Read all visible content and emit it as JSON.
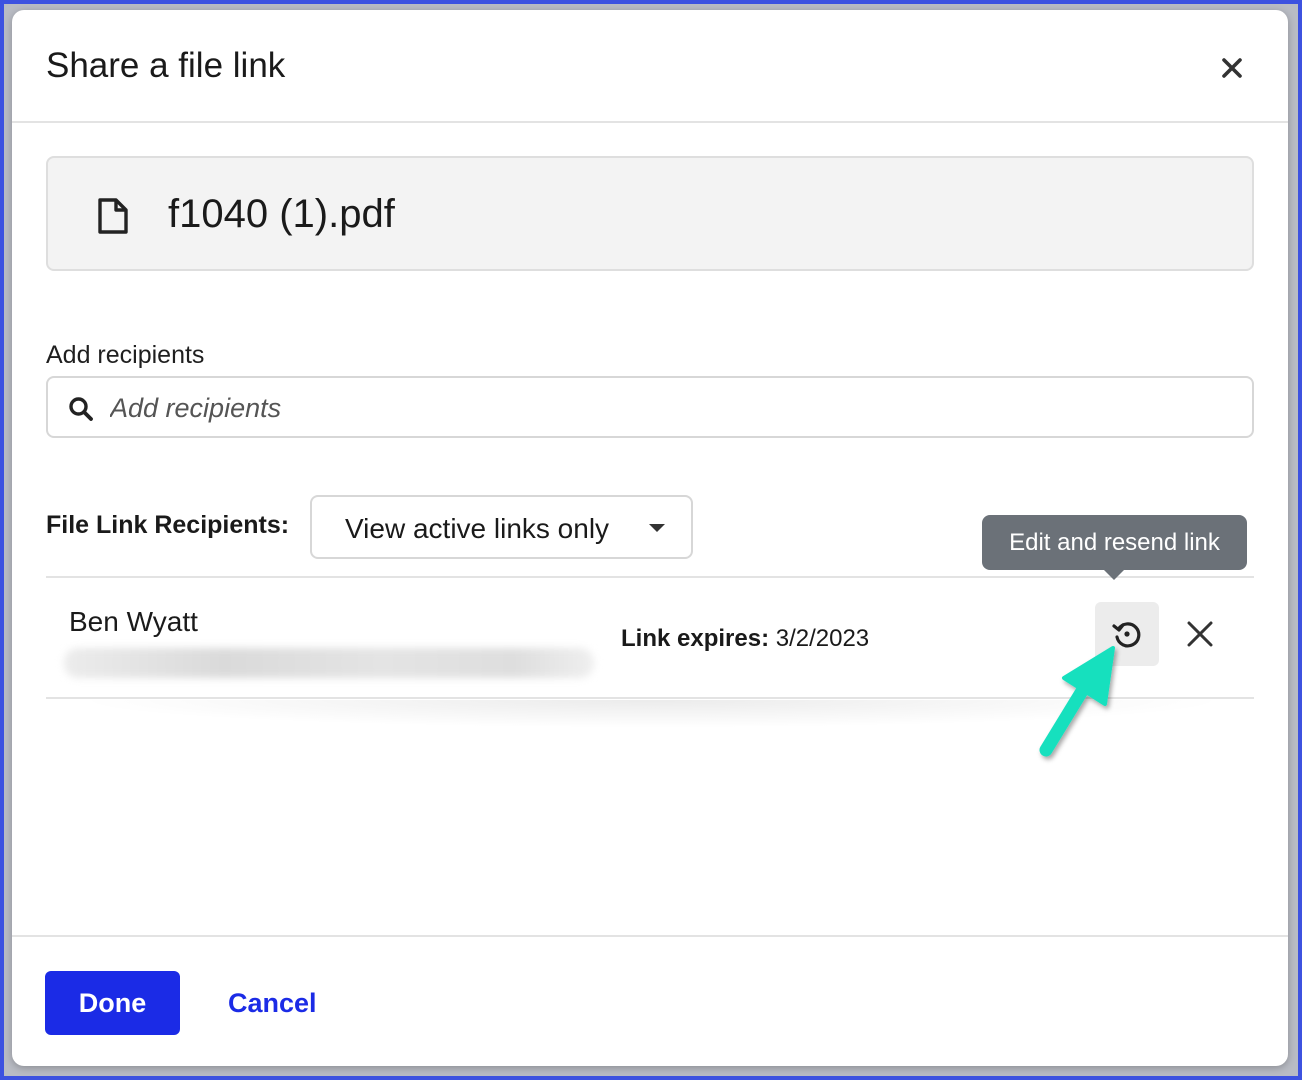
{
  "dialog": {
    "title": "Share a file link"
  },
  "file": {
    "name": "f1040 (1).pdf",
    "icon": "document-icon"
  },
  "recipients_field": {
    "label": "Add recipients",
    "placeholder": "Add recipients",
    "value": ""
  },
  "file_link_recipients": {
    "label": "File Link Recipients:",
    "filter": {
      "selected": "View active links only"
    },
    "rows": [
      {
        "name": "Ben Wyatt",
        "expires_label": "Link expires:",
        "expires_value": "3/2/2023"
      }
    ]
  },
  "tooltip": {
    "text": "Edit and resend link"
  },
  "footer": {
    "done_label": "Done",
    "cancel_label": "Cancel"
  },
  "colors": {
    "primary": "#1b2be6",
    "tooltip_bg": "#6b7178",
    "callout_arrow": "#19e0be",
    "frame": "#3d52e0"
  }
}
